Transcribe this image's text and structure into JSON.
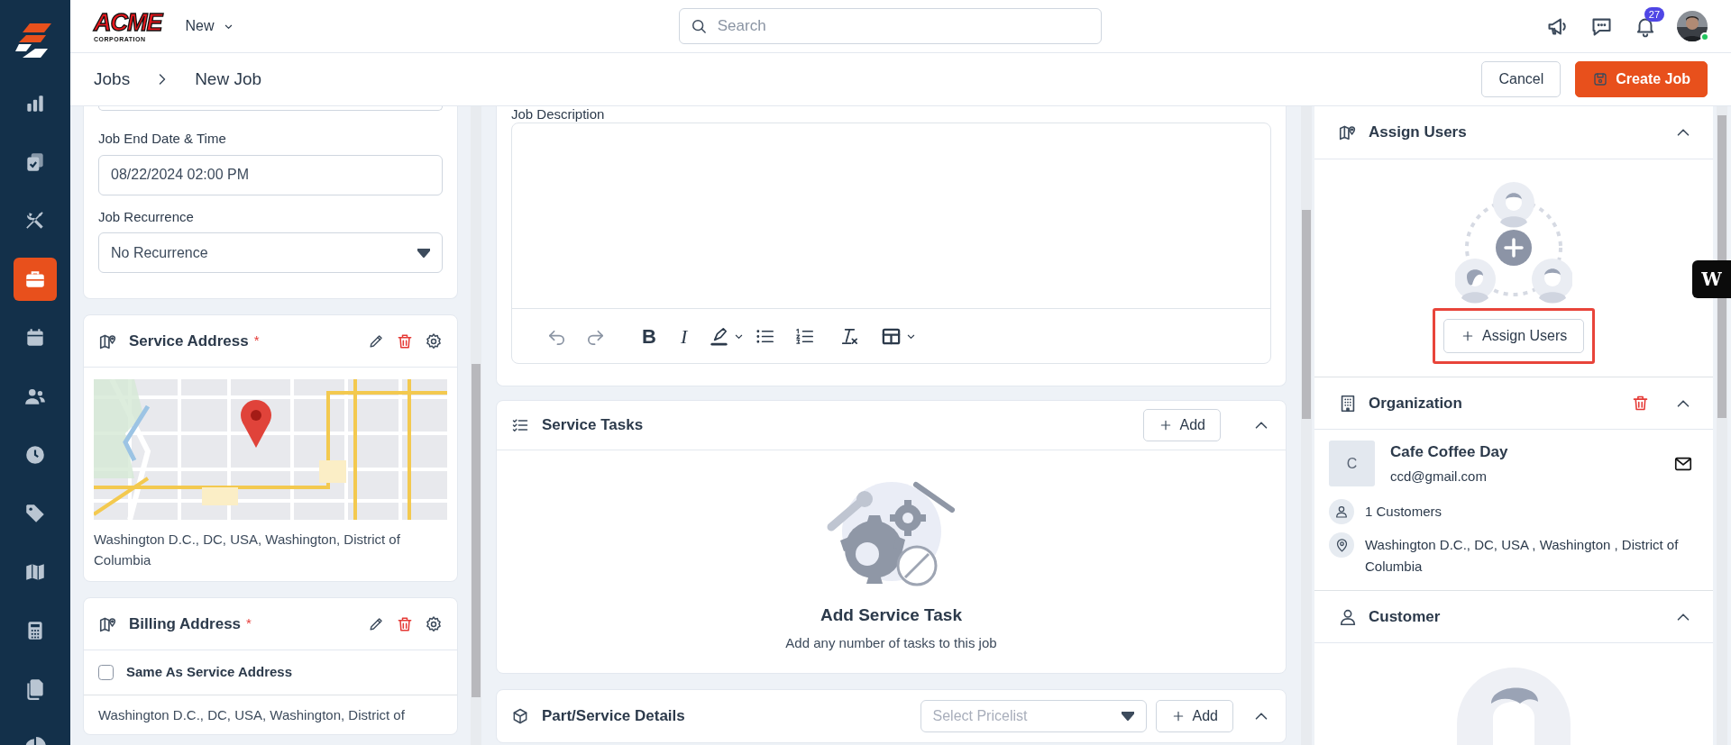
{
  "sidebar": {
    "items": [
      {
        "kind": "chart",
        "selected": false
      },
      {
        "kind": "clipboard",
        "selected": false
      },
      {
        "kind": "tools",
        "selected": false
      },
      {
        "kind": "briefcase",
        "selected": true
      },
      {
        "kind": "calendar",
        "selected": false
      },
      {
        "kind": "users",
        "selected": false
      },
      {
        "kind": "clock",
        "selected": false
      },
      {
        "kind": "tag",
        "selected": false
      },
      {
        "kind": "map",
        "selected": false
      },
      {
        "kind": "calculator",
        "selected": false
      },
      {
        "kind": "files",
        "selected": false
      },
      {
        "kind": "pie",
        "selected": false
      }
    ]
  },
  "topbar": {
    "logo": {
      "name": "ACME",
      "sub": "CORPORATION"
    },
    "new_menu": "New",
    "search": {
      "placeholder": "Search"
    },
    "notifications": "27",
    "user_online": true
  },
  "breadcrumb": [
    "Jobs",
    "New Job"
  ],
  "actions": {
    "cancel": "Cancel",
    "create": "Create Job"
  },
  "schedule_card": {
    "fields": [
      {
        "kind": "input",
        "label": "Job End Date & Time",
        "value": "08/22/2024 02:00 PM"
      },
      {
        "kind": "select",
        "label": "Job Recurrence",
        "value": "No Recurrence"
      }
    ]
  },
  "service_address": {
    "title": "Service Address",
    "required_mark": "*",
    "address": "Washington D.C., DC, USA, Washington, District of Columbia"
  },
  "billing_address": {
    "title": "Billing Address",
    "required_mark": "*",
    "same_as_service": {
      "label": "Same As Service Address",
      "checked": false
    },
    "address": "Washington D.C., DC, USA, Washington, District of"
  },
  "description": {
    "label": "Job Description",
    "toolbar": [
      {
        "kind": "undo",
        "disabled": true
      },
      {
        "kind": "redo",
        "disabled": true
      },
      {
        "kind": "bold",
        "label": "B",
        "disabled": false
      },
      {
        "kind": "italic",
        "label": "I",
        "disabled": false
      },
      {
        "kind": "highlight",
        "disabled": false
      },
      {
        "kind": "bullets",
        "disabled": false
      },
      {
        "kind": "numbers",
        "disabled": false
      },
      {
        "kind": "clear",
        "disabled": false
      },
      {
        "kind": "table",
        "disabled": false
      }
    ]
  },
  "service_tasks": {
    "title": "Service Tasks",
    "add": "Add",
    "expanded": true,
    "empty_title": "Add Service Task",
    "empty_text": "Add any number of tasks to this job"
  },
  "parts": {
    "title": "Part/Service Details",
    "pricelist": {
      "placeholder": "Select Pricelist"
    },
    "add": "Add",
    "expanded": true
  },
  "assign_users": {
    "title": "Assign Users",
    "expanded": true,
    "button": "Assign Users",
    "highlighted": true
  },
  "organization": {
    "title": "Organization",
    "expanded": true,
    "initial": "C",
    "name": "Cafe Coffee Day",
    "email": "ccd@gmail.com",
    "customers": "1 Customers",
    "address": "Washington D.C., DC, USA , Washington , District of Columbia"
  },
  "customer": {
    "title": "Customer",
    "expanded": true
  },
  "help_widget": {
    "label": "W"
  }
}
